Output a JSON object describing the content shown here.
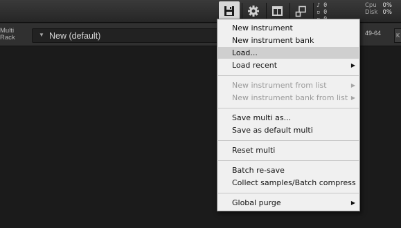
{
  "header": {
    "meters": [
      {
        "icon": "note-icon",
        "value": "0"
      },
      {
        "icon": "memory-icon",
        "value": "0"
      },
      {
        "icon": "disk-icon",
        "value": "0"
      }
    ],
    "cpu": {
      "label": "Cpu",
      "value": "0%"
    },
    "disk": {
      "label": "Disk",
      "value": "0%"
    }
  },
  "rack": {
    "label_line1": "Multi",
    "label_line2": "Rack",
    "multi_name": "New (default)",
    "range": "49-64",
    "k_label": "K"
  },
  "menu": {
    "items": [
      {
        "label": "New instrument",
        "submenu": false,
        "disabled": false
      },
      {
        "label": "New instrument bank",
        "submenu": false,
        "disabled": false
      },
      {
        "label": "Load...",
        "submenu": false,
        "disabled": false,
        "highlighted": true
      },
      {
        "label": "Load recent",
        "submenu": true,
        "disabled": false
      },
      {
        "label": "New instrument from list",
        "submenu": true,
        "disabled": true
      },
      {
        "label": "New instrument bank from list",
        "submenu": true,
        "disabled": true
      },
      {
        "label": "Save multi as...",
        "submenu": false,
        "disabled": false
      },
      {
        "label": "Save as default multi",
        "submenu": false,
        "disabled": false
      },
      {
        "label": "Reset multi",
        "submenu": false,
        "disabled": false
      },
      {
        "label": "Batch re-save",
        "submenu": false,
        "disabled": false
      },
      {
        "label": "Collect samples/Batch compress",
        "submenu": false,
        "disabled": false
      },
      {
        "label": "Global purge",
        "submenu": true,
        "disabled": false
      }
    ],
    "submenu_glyph": "▶"
  }
}
